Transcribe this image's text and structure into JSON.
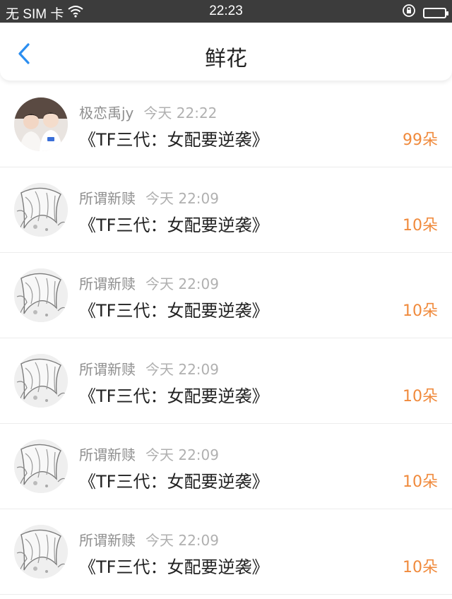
{
  "status_bar": {
    "carrier": "无 SIM 卡",
    "time": "22:23",
    "wifi_icon": "wifi-icon",
    "lock_icon": "rotation-lock-icon",
    "battery_icon": "battery-icon"
  },
  "nav": {
    "title": "鲜花",
    "back_icon": "chevron-left-icon"
  },
  "colors": {
    "accent": "#2b8ef0",
    "count": "#f08a3c",
    "status_bar_bg": "#3c3c3c"
  },
  "records": [
    {
      "user": "极恋禹jy",
      "time": "今天 22:22",
      "book": "《TF三代：女配要逆袭》",
      "count": "99朵",
      "avatar": "photo"
    },
    {
      "user": "所谓新赎",
      "time": "今天 22:09",
      "book": "《TF三代：女配要逆袭》",
      "count": "10朵",
      "avatar": "sketch"
    },
    {
      "user": "所谓新赎",
      "time": "今天 22:09",
      "book": "《TF三代：女配要逆袭》",
      "count": "10朵",
      "avatar": "sketch"
    },
    {
      "user": "所谓新赎",
      "time": "今天 22:09",
      "book": "《TF三代：女配要逆袭》",
      "count": "10朵",
      "avatar": "sketch"
    },
    {
      "user": "所谓新赎",
      "time": "今天 22:09",
      "book": "《TF三代：女配要逆袭》",
      "count": "10朵",
      "avatar": "sketch"
    },
    {
      "user": "所谓新赎",
      "time": "今天 22:09",
      "book": "《TF三代：女配要逆袭》",
      "count": "10朵",
      "avatar": "sketch"
    }
  ]
}
